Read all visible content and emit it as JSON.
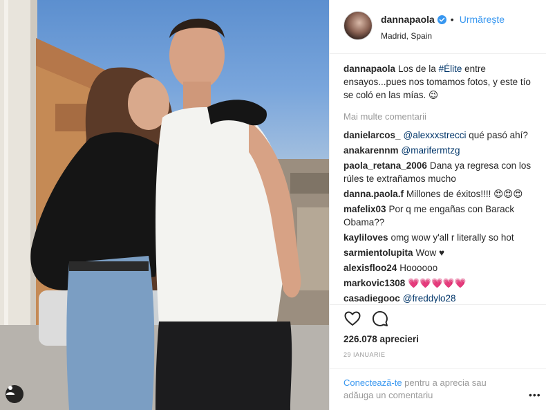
{
  "post": {
    "photo_alt": "Instagram photo",
    "user_tag_icon": "person-icon"
  },
  "header": {
    "username": "dannapaola",
    "separator": "•",
    "follow_label": "Urmărește",
    "location": "Madrid, Spain",
    "verified_icon": "verified-badge-icon"
  },
  "caption": {
    "username": "dannapaola",
    "text_before": "Los de la ",
    "hashtag": "#Élite",
    "text_after": " entre ensayos...pues nos tomamos fotos, y este tío se coló en las mías. 😉"
  },
  "more_comments_label": "Mai multe comentarii",
  "comments": [
    {
      "username": "danielarcos_",
      "mention": "@alexxxstrecci",
      "text": " qué pasó ahí?"
    },
    {
      "username": "anakarennm",
      "mention": "@marifermtzg",
      "text": ""
    },
    {
      "username": "paola_retana_2006",
      "mention": "",
      "text": "Dana ya regresa con los rúles te extrañamos mucho"
    },
    {
      "username": "danna.paola.f",
      "mention": "",
      "text": "Millones de éxitos!!!! 😍😍😍"
    },
    {
      "username": "mafelix03",
      "mention": "",
      "text": "Por q me engañas con Barack Obama??"
    },
    {
      "username": "kayliloves",
      "mention": "",
      "text": "omg wow y'all r literally so hot"
    },
    {
      "username": "sarmientolupita",
      "mention": "",
      "text": "Wow ♥"
    },
    {
      "username": "alexisfloo24",
      "mention": "",
      "text": "Hoooooo"
    },
    {
      "username": "markovic1308",
      "mention": "",
      "text": "💗💗💗💗💗"
    },
    {
      "username": "casadiegooc",
      "mention": "@freddylo28",
      "text": ""
    }
  ],
  "actions": {
    "like_icon": "heart-icon",
    "comment_icon": "comment-bubble-icon",
    "likes": "226.078 aprecieri",
    "date": "29 IANUARIE"
  },
  "footer": {
    "login_link": "Conectează-te",
    "login_text": " pentru a aprecia sau adăuga un comentariu",
    "more_options": "•••"
  },
  "colors": {
    "accent": "#3897f0",
    "link_dark": "#003569",
    "muted": "#999999",
    "text": "#262626"
  }
}
